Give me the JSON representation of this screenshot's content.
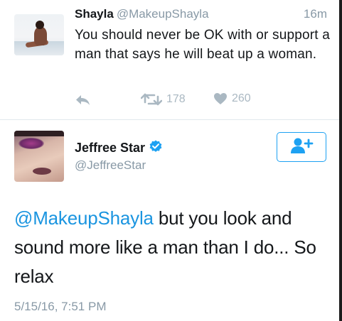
{
  "reply_tweet": {
    "display_name": "Shayla",
    "handle": "@MakeupShayla",
    "time": "16m",
    "text": "You should never be OK with or support a man that says he will beat up a woman.",
    "retweet_count": "178",
    "like_count": "260"
  },
  "main_tweet": {
    "display_name": "Jeffree Star",
    "handle": "@JeffreeStar",
    "mention": "@MakeupShayla",
    "text": " but you look and sound more like a man than I do... So relax",
    "timestamp": "5/15/16, 7:51 PM"
  },
  "icons": {
    "reply": "reply-icon",
    "retweet": "retweet-icon",
    "like": "heart-icon",
    "verified": "verified-badge-icon",
    "follow": "add-user-icon"
  },
  "colors": {
    "accent": "#1da1f2",
    "link": "#1b95e0",
    "muted": "#8899a6",
    "action_icon": "#aab8c2"
  }
}
